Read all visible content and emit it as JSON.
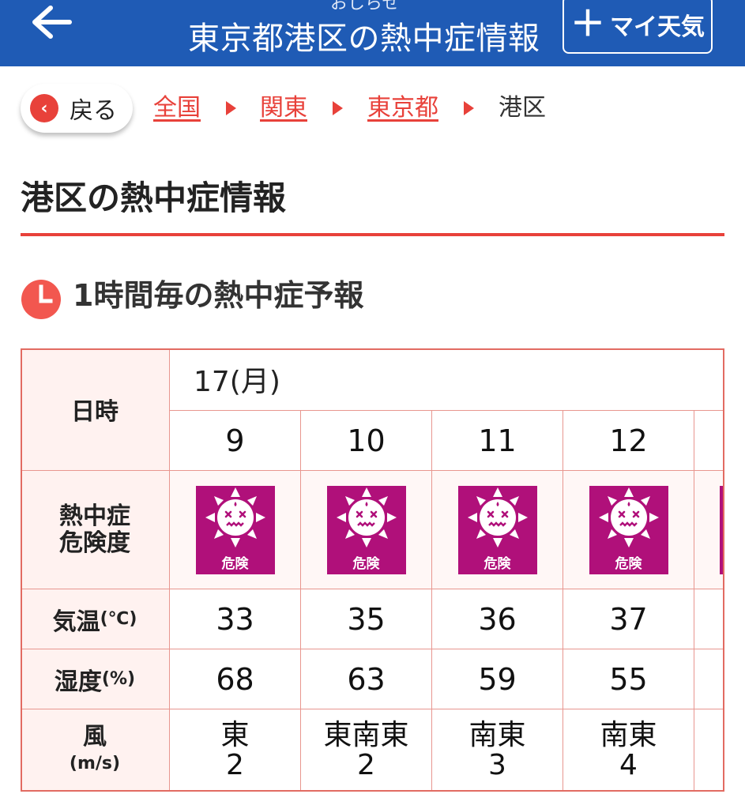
{
  "header": {
    "subtitle": "おしらせ",
    "title": "東京都港区の熱中症情報",
    "my_weather_label": "マイ天気"
  },
  "breadcrumb": {
    "back_label": "戻る",
    "items": [
      "全国",
      "関東",
      "東京都",
      "港区"
    ]
  },
  "page_title": "港区の熱中症情報",
  "section_title": "1時間毎の熱中症予報",
  "table": {
    "row_labels": {
      "datetime": "日時",
      "risk_line1": "熱中症",
      "risk_line2": "危険度",
      "temp_main": "気温",
      "temp_unit": "(℃)",
      "humidity_main": "湿度",
      "humidity_unit": "(%)",
      "wind_main": "風",
      "wind_unit": "(m/s)"
    },
    "date": "17(月)",
    "columns": [
      {
        "hour": "9",
        "risk": "危険",
        "temp": "33",
        "humidity": "68",
        "wind_dir": "東",
        "wind_speed": "2"
      },
      {
        "hour": "10",
        "risk": "危険",
        "temp": "35",
        "humidity": "63",
        "wind_dir": "東南東",
        "wind_speed": "2"
      },
      {
        "hour": "11",
        "risk": "危険",
        "temp": "36",
        "humidity": "59",
        "wind_dir": "南東",
        "wind_speed": "3"
      },
      {
        "hour": "12",
        "risk": "危険",
        "temp": "37",
        "humidity": "55",
        "wind_dir": "南東",
        "wind_speed": "4"
      }
    ]
  },
  "colors": {
    "header_bg": "#1f5bb5",
    "accent_red": "#e8413a",
    "risk_danger": "#b0107a",
    "row_head_bg": "#fff2f0"
  }
}
